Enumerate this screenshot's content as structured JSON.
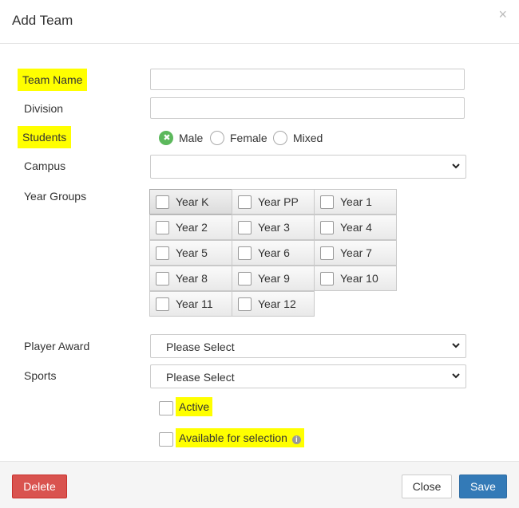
{
  "header": {
    "title": "Add Team",
    "close_glyph": "×"
  },
  "form": {
    "team_name": {
      "label": "Team Name",
      "value": ""
    },
    "division": {
      "label": "Division",
      "value": ""
    },
    "students": {
      "label": "Students",
      "options": [
        {
          "label": "Male",
          "selected": true
        },
        {
          "label": "Female",
          "selected": false
        },
        {
          "label": "Mixed",
          "selected": false
        }
      ]
    },
    "campus": {
      "label": "Campus",
      "value": ""
    },
    "year_groups": {
      "label": "Year Groups",
      "items": [
        {
          "label": "Year K",
          "checked": false
        },
        {
          "label": "Year PP",
          "checked": false
        },
        {
          "label": "Year 1",
          "checked": false
        },
        {
          "label": "Year 2",
          "checked": false
        },
        {
          "label": "Year 3",
          "checked": false
        },
        {
          "label": "Year 4",
          "checked": false
        },
        {
          "label": "Year 5",
          "checked": false
        },
        {
          "label": "Year 6",
          "checked": false
        },
        {
          "label": "Year 7",
          "checked": false
        },
        {
          "label": "Year 8",
          "checked": false
        },
        {
          "label": "Year 9",
          "checked": false
        },
        {
          "label": "Year 10",
          "checked": false
        },
        {
          "label": "Year 11",
          "checked": false
        },
        {
          "label": "Year 12",
          "checked": false
        }
      ]
    },
    "player_award": {
      "label": "Player Award",
      "value": "Please Select"
    },
    "sports": {
      "label": "Sports",
      "value": "Please Select"
    },
    "active": {
      "label": "Active",
      "checked": false
    },
    "available": {
      "label": "Available for selection",
      "checked": false,
      "info_icon": "info-icon"
    }
  },
  "footer": {
    "delete_label": "Delete",
    "close_label": "Close",
    "save_label": "Save"
  },
  "colors": {
    "highlight": "#ffff00",
    "delete": "#d9534f",
    "save": "#337ab7",
    "radio_on": "#5cb85c"
  }
}
